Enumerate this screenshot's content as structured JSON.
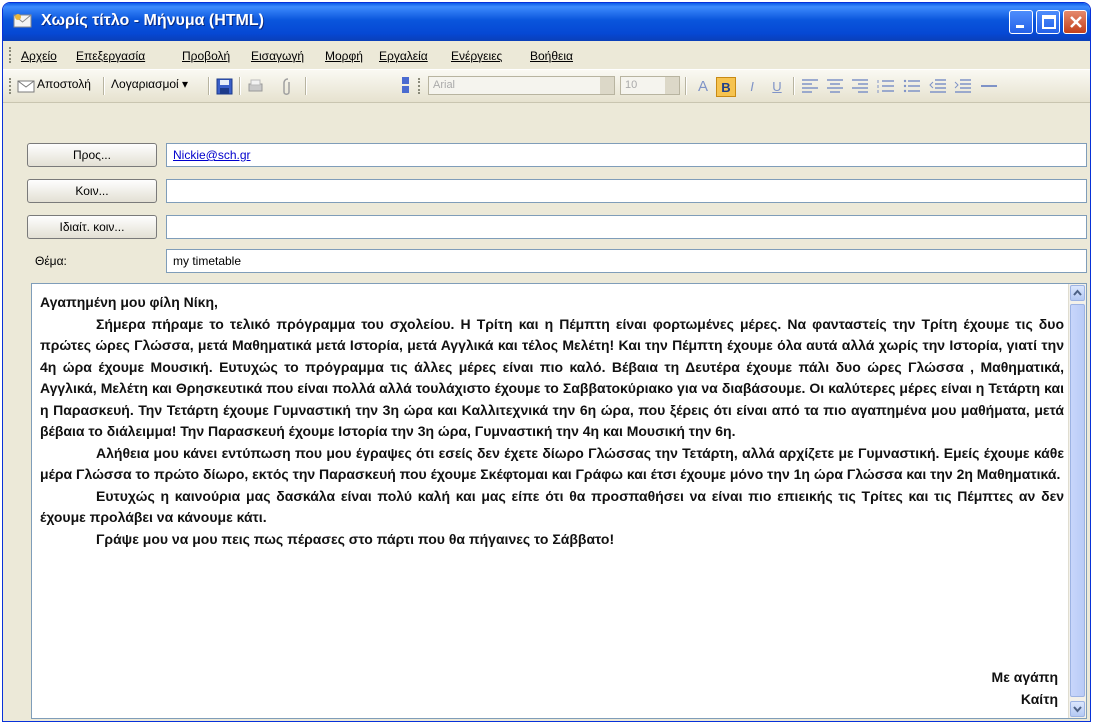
{
  "window": {
    "title": "Χωρίς τίτλο - Μήνυμα (HTML)"
  },
  "menu": [
    "Αρχείο",
    "Επεξεργασία",
    "Προβολή",
    "Εισαγωγή",
    "Μορφή",
    "Εργαλεία",
    "Ενέργειες",
    "Βοήθεια"
  ],
  "toolbar": {
    "send_label": "Αποστολή",
    "accounts_label": "Λογαριασμοί ▾",
    "font_name": "Arial",
    "font_size": "10",
    "bold_label": "B",
    "italic_label": "I",
    "underline_label": "U"
  },
  "header": {
    "to_label": "Προς...",
    "to_value": "Nickie@sch.gr",
    "cc_label": "Κοιν...",
    "cc_value": "",
    "bcc_label": "Ιδιαίτ. κοιν...",
    "bcc_value": "",
    "subject_label": "Θέμα:",
    "subject_value": "my timetable"
  },
  "message": {
    "greeting": "Αγαπημένη μου φίλη Νίκη,",
    "paragraphs": [
      "Σήμερα πήραμε το τελικό πρόγραμμα του σχολείου. Η Τρίτη και η Πέμπτη είναι φορτωμένες μέρες. Να φανταστείς την Τρίτη έχουμε τις δυο πρώτες ώρες Γλώσσα, μετά Μαθηματικά μετά Ιστορία, μετά Αγγλικά και τέλος Μελέτη! Και την Πέμπτη έχουμε όλα αυτά αλλά χωρίς την Ιστορία, γιατί την 4η ώρα έχουμε Μουσική. Ευτυχώς το πρόγραμμα τις άλλες μέρες είναι πιο καλό. Βέβαια τη Δευτέρα έχουμε πάλι δυο ώρες Γλώσσα , Μαθηματικά, Αγγλικά, Μελέτη και Θρησκευτικά που είναι πολλά αλλά τουλάχιστο έχουμε το Σαββατοκύριακο για να διαβάσουμε. Οι καλύτερες μέρες είναι η Τετάρτη και η Παρασκευή. Την Τετάρτη έχουμε Γυμναστική την 3η ώρα και Καλλιτεχνικά την 6η ώρα, που ξέρεις ότι είναι από τα πιο αγαπημένα μου μαθήματα, μετά βέβαια το διάλειμμα! Την Παρασκευή έχουμε Ιστορία την 3η ώρα, Γυμναστική την 4η και Μουσική την 6η.",
      "Αλήθεια μου κάνει εντύπωση που μου έγραψες ότι εσείς δεν έχετε δίωρο Γλώσσας την Τετάρτη, αλλά αρχίζετε με Γυμναστική. Εμείς έχουμε κάθε μέρα Γλώσσα το πρώτο δίωρο, εκτός την Παρασκευή που έχουμε Σκέφτομαι και Γράφω και έτσι έχουμε μόνο την 1η ώρα Γλώσσα και την 2η Μαθηματικά.",
      "Ευτυχώς η καινούρια μας δασκάλα είναι πολύ καλή και μας είπε ότι θα προσπαθήσει να είναι πιο επιεικής τις Τρίτες και τις Πέμπτες αν δεν έχουμε προλάβει να κάνουμε κάτι.",
      "Γράψε μου να μου πεις πως πέρασες στο πάρτι που θα πήγαινες το Σάββατο!"
    ],
    "closing": "Με αγάπη",
    "signature": "Καίτη"
  }
}
